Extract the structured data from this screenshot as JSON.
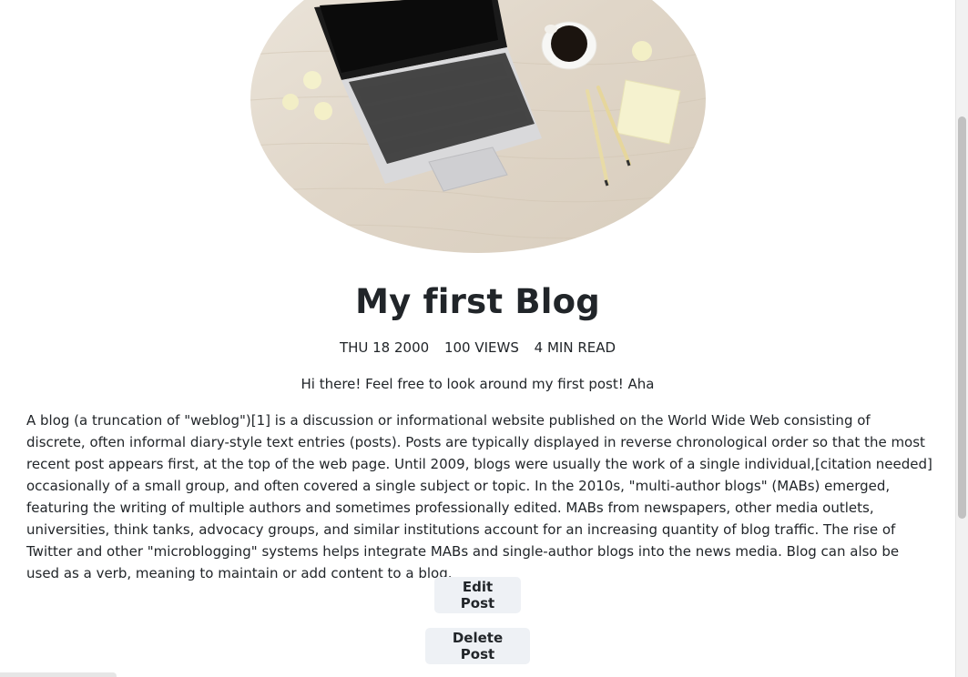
{
  "post": {
    "title": "My first Blog",
    "meta": {
      "date": "THU 18 2000",
      "views": "100 VIEWS",
      "read_time": "4 MIN READ"
    },
    "subtitle": "Hi there! Feel free to look around my first post! Aha",
    "body": "A blog (a truncation of \"weblog\")[1] is a discussion or informational website published on the World Wide Web consisting of discrete, often informal diary-style text entries (posts). Posts are typically displayed in reverse chronological order so that the most recent post appears first, at the top of the web page. Until 2009, blogs were usually the work of a single individual,[citation needed] occasionally of a small group, and often covered a single subject or topic. In the 2010s, \"multi-author blogs\" (MABs) emerged, featuring the writing of multiple authors and sometimes professionally edited. MABs from newspapers, other media outlets, universities, think tanks, advocacy groups, and similar institutions account for an increasing quantity of blog traffic. The rise of Twitter and other \"microblogging\" systems helps integrate MABs and single-author blogs into the news media. Blog can also be used as a verb, meaning to maintain or add content to a blog."
  },
  "actions": {
    "edit_label": "Edit Post",
    "delete_label": "Delete Post"
  },
  "colors": {
    "text": "#212529",
    "button_bg": "#eef1f5",
    "desk": "#e3d9cc"
  }
}
